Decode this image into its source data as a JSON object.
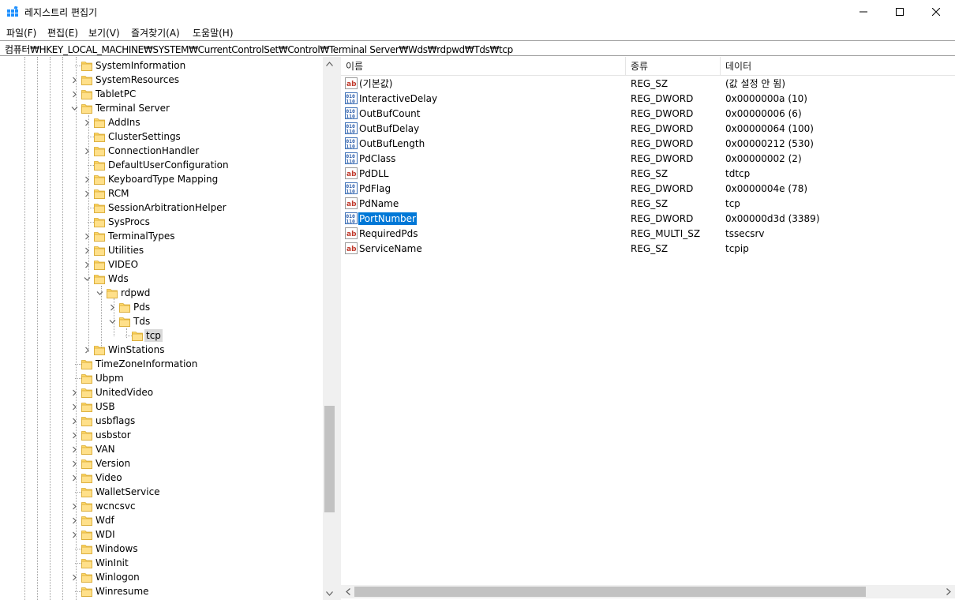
{
  "window": {
    "title": "레지스트리 편집기",
    "icon": "registry-editor-icon",
    "controls": {
      "minimize": "minimize-icon",
      "maximize": "maximize-icon",
      "close": "close-icon"
    }
  },
  "menu": [
    {
      "label": "파일(F)"
    },
    {
      "label": "편집(E)"
    },
    {
      "label": "보기(V)"
    },
    {
      "label": "즐겨찾기(A)"
    },
    {
      "label": "도움말(H)"
    }
  ],
  "address": "컴퓨터₩HKEY_LOCAL_MACHINE₩SYSTEM₩CurrentControlSet₩Control₩Terminal Server₩Wds₩rdpwd₩Tds₩tcp",
  "tree": [
    {
      "label": "SystemInformation",
      "level": 0,
      "expander": "none"
    },
    {
      "label": "SystemResources",
      "level": 0,
      "expander": "collapsed"
    },
    {
      "label": "TabletPC",
      "level": 0,
      "expander": "collapsed"
    },
    {
      "label": "Terminal Server",
      "level": 0,
      "expander": "expanded"
    },
    {
      "label": "AddIns",
      "level": 1,
      "expander": "collapsed"
    },
    {
      "label": "ClusterSettings",
      "level": 1,
      "expander": "none"
    },
    {
      "label": "ConnectionHandler",
      "level": 1,
      "expander": "collapsed"
    },
    {
      "label": "DefaultUserConfiguration",
      "level": 1,
      "expander": "none"
    },
    {
      "label": "KeyboardType Mapping",
      "level": 1,
      "expander": "collapsed"
    },
    {
      "label": "RCM",
      "level": 1,
      "expander": "collapsed"
    },
    {
      "label": "SessionArbitrationHelper",
      "level": 1,
      "expander": "none"
    },
    {
      "label": "SysProcs",
      "level": 1,
      "expander": "none"
    },
    {
      "label": "TerminalTypes",
      "level": 1,
      "expander": "collapsed"
    },
    {
      "label": "Utilities",
      "level": 1,
      "expander": "collapsed"
    },
    {
      "label": "VIDEO",
      "level": 1,
      "expander": "collapsed"
    },
    {
      "label": "Wds",
      "level": 1,
      "expander": "expanded"
    },
    {
      "label": "rdpwd",
      "level": 2,
      "expander": "expanded"
    },
    {
      "label": "Pds",
      "level": 3,
      "expander": "collapsed"
    },
    {
      "label": "Tds",
      "level": 3,
      "expander": "expanded"
    },
    {
      "label": "tcp",
      "level": 4,
      "expander": "none",
      "selected": true
    },
    {
      "label": "WinStations",
      "level": 1,
      "expander": "collapsed"
    },
    {
      "label": "TimeZoneInformation",
      "level": 0,
      "expander": "none"
    },
    {
      "label": "Ubpm",
      "level": 0,
      "expander": "none"
    },
    {
      "label": "UnitedVideo",
      "level": 0,
      "expander": "collapsed"
    },
    {
      "label": "USB",
      "level": 0,
      "expander": "collapsed"
    },
    {
      "label": "usbflags",
      "level": 0,
      "expander": "collapsed"
    },
    {
      "label": "usbstor",
      "level": 0,
      "expander": "collapsed"
    },
    {
      "label": "VAN",
      "level": 0,
      "expander": "collapsed"
    },
    {
      "label": "Version",
      "level": 0,
      "expander": "collapsed"
    },
    {
      "label": "Video",
      "level": 0,
      "expander": "collapsed"
    },
    {
      "label": "WalletService",
      "level": 0,
      "expander": "none"
    },
    {
      "label": "wcncsvc",
      "level": 0,
      "expander": "collapsed"
    },
    {
      "label": "Wdf",
      "level": 0,
      "expander": "collapsed"
    },
    {
      "label": "WDI",
      "level": 0,
      "expander": "collapsed"
    },
    {
      "label": "Windows",
      "level": 0,
      "expander": "none"
    },
    {
      "label": "WinInit",
      "level": 0,
      "expander": "none"
    },
    {
      "label": "Winlogon",
      "level": 0,
      "expander": "collapsed"
    },
    {
      "label": "Winresume",
      "level": 0,
      "expander": "none"
    }
  ],
  "list": {
    "columns": {
      "name": "이름",
      "type": "종류",
      "data": "데이터"
    },
    "rows": [
      {
        "name": "(기본값)",
        "type": "REG_SZ",
        "data": "(값 설정 안 됨)",
        "icon": "string-value-icon"
      },
      {
        "name": "InteractiveDelay",
        "type": "REG_DWORD",
        "data": "0x0000000a (10)",
        "icon": "binary-value-icon"
      },
      {
        "name": "OutBufCount",
        "type": "REG_DWORD",
        "data": "0x00000006 (6)",
        "icon": "binary-value-icon"
      },
      {
        "name": "OutBufDelay",
        "type": "REG_DWORD",
        "data": "0x00000064 (100)",
        "icon": "binary-value-icon"
      },
      {
        "name": "OutBufLength",
        "type": "REG_DWORD",
        "data": "0x00000212 (530)",
        "icon": "binary-value-icon"
      },
      {
        "name": "PdClass",
        "type": "REG_DWORD",
        "data": "0x00000002 (2)",
        "icon": "binary-value-icon"
      },
      {
        "name": "PdDLL",
        "type": "REG_SZ",
        "data": "tdtcp",
        "icon": "string-value-icon"
      },
      {
        "name": "PdFlag",
        "type": "REG_DWORD",
        "data": "0x0000004e (78)",
        "icon": "binary-value-icon"
      },
      {
        "name": "PdName",
        "type": "REG_SZ",
        "data": "tcp",
        "icon": "string-value-icon"
      },
      {
        "name": "PortNumber",
        "type": "REG_DWORD",
        "data": "0x00000d3d (3389)",
        "icon": "binary-value-icon",
        "selected": true
      },
      {
        "name": "RequiredPds",
        "type": "REG_MULTI_SZ",
        "data": "tssecsrv",
        "icon": "string-value-icon"
      },
      {
        "name": "ServiceName",
        "type": "REG_SZ",
        "data": "tcpip",
        "icon": "string-value-icon"
      }
    ]
  },
  "colors": {
    "selection": "#0078d7",
    "tree_selection": "#d9d9d9",
    "folder": "#ffd866"
  }
}
